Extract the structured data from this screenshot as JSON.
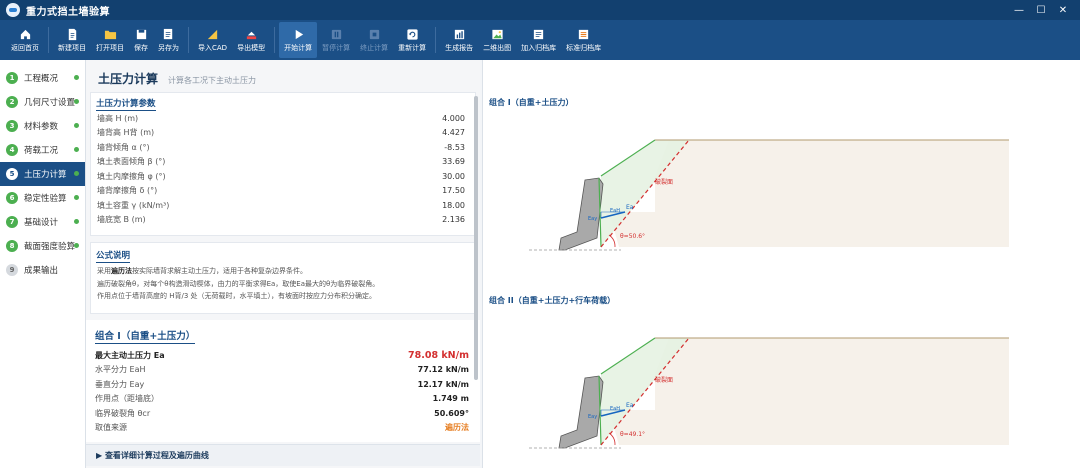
{
  "app": {
    "title": "重力式挡土墙验算"
  },
  "window_controls": {
    "minimize": "—",
    "maximize": "☐",
    "close": "✕"
  },
  "toolbar": [
    {
      "id": "home",
      "label": "返回首页",
      "icon": "home-icon",
      "state": "normal"
    },
    {
      "sep": true
    },
    {
      "id": "new",
      "label": "新建项目",
      "icon": "new-file-icon",
      "state": "normal"
    },
    {
      "id": "open",
      "label": "打开项目",
      "icon": "folder-icon",
      "state": "normal"
    },
    {
      "id": "save",
      "label": "保存",
      "icon": "save-icon",
      "state": "normal"
    },
    {
      "id": "saveas",
      "label": "另存为",
      "icon": "save-as-icon",
      "state": "normal"
    },
    {
      "sep": true
    },
    {
      "id": "cad",
      "label": "导入CAD",
      "icon": "cad-icon",
      "state": "normal"
    },
    {
      "id": "export",
      "label": "导出模型",
      "icon": "export-icon",
      "state": "normal"
    },
    {
      "sep": true
    },
    {
      "id": "start",
      "label": "开始计算",
      "icon": "play-icon",
      "state": "active"
    },
    {
      "id": "pause",
      "label": "暂停计算",
      "icon": "pause-icon",
      "state": "disabled"
    },
    {
      "id": "stop",
      "label": "终止计算",
      "icon": "stop-icon",
      "state": "disabled"
    },
    {
      "id": "recalc",
      "label": "重新计算",
      "icon": "refresh-icon",
      "state": "normal"
    },
    {
      "sep": true
    },
    {
      "id": "report",
      "label": "生成报告",
      "icon": "chart-icon",
      "state": "normal"
    },
    {
      "id": "draw2d",
      "label": "二维出图",
      "icon": "picture-icon",
      "state": "normal"
    },
    {
      "id": "addlib",
      "label": "加入归档库",
      "icon": "archive-add-icon",
      "state": "normal"
    },
    {
      "id": "stdlib",
      "label": "标准归档库",
      "icon": "archive-icon",
      "state": "normal"
    }
  ],
  "sidebar": {
    "items": [
      {
        "num": "1",
        "label": "工程概况",
        "done": true
      },
      {
        "num": "2",
        "label": "几何尺寸设置",
        "done": true
      },
      {
        "num": "3",
        "label": "材料参数",
        "done": true
      },
      {
        "num": "4",
        "label": "荷载工况",
        "done": true
      },
      {
        "num": "5",
        "label": "土压力计算",
        "done": true,
        "active": true
      },
      {
        "num": "6",
        "label": "稳定性验算",
        "done": true
      },
      {
        "num": "7",
        "label": "基础设计",
        "done": true
      },
      {
        "num": "8",
        "label": "截面强度验算",
        "done": true
      },
      {
        "num": "9",
        "label": "成果输出",
        "done": false
      }
    ]
  },
  "page": {
    "title": "土压力计算",
    "subtitle": "计算各工况下主动土压力"
  },
  "params": {
    "title": "土压力计算参数",
    "rows": [
      {
        "k": "墙高 H (m)",
        "v": "4.000"
      },
      {
        "k": "墙背高 H背 (m)",
        "v": "4.427"
      },
      {
        "k": "墙背倾角 α (°)",
        "v": "-8.53"
      },
      {
        "k": "填土表面倾角 β (°)",
        "v": "33.69"
      },
      {
        "k": "填土内摩擦角 φ (°)",
        "v": "30.00"
      },
      {
        "k": "墙背摩擦角 δ (°)",
        "v": "17.50"
      },
      {
        "k": "填土容重 γ (kN/m³)",
        "v": "18.00"
      },
      {
        "k": "墙底宽 B (m)",
        "v": "2.136"
      }
    ]
  },
  "formula": {
    "title": "公式说明",
    "line1_pre": "采用",
    "line1_bold": "遍历法",
    "line1_post": "按实际墙背求解主动土压力，适用于各种复杂边界条件。",
    "line2": "遍历破裂角θ，对每个θ构造滑动楔体，由力的平衡求得Ea，取使Ea最大的θ为临界破裂角。",
    "line3": "作用点位于墙背高度的 H背/3 处（无荷载时，水平填土），有坡面时按应力分布积分确定。"
  },
  "result": {
    "title": "组合 I（自重+土压力）",
    "rows": [
      {
        "k": "最大主动土压力 Ea",
        "v": "78.08 kN/m",
        "style": "main"
      },
      {
        "k": "水平分力 EaH",
        "v": "77.12 kN/m",
        "style": "normal"
      },
      {
        "k": "垂直分力 Eay",
        "v": "12.17 kN/m",
        "style": "normal"
      },
      {
        "k": "作用点（距墙底）",
        "v": "1.749 m",
        "style": "normal"
      },
      {
        "k": "临界破裂角 θcr",
        "v": "50.609°",
        "style": "normal"
      },
      {
        "k": "取值来源",
        "v": "遍历法",
        "style": "orange"
      }
    ],
    "detail_link": "▶  查看详细计算过程及遍历曲线"
  },
  "figures": [
    {
      "title": "组合 I（自重+土压力）",
      "theta_label": "θ=50.6°",
      "ea": "Ea",
      "eah": "EaH",
      "eay": "Eay",
      "slip": "破裂面"
    },
    {
      "title": "组合 II（自重+土压力+行车荷载）",
      "theta_label": "θ=49.1°",
      "ea": "Ea",
      "eah": "EaH",
      "eay": "Eay",
      "slip": "破裂面"
    }
  ],
  "colors": {
    "brand": "#1b4f86",
    "title_bar": "#12406f",
    "done": "#4caf50",
    "red": "#d32f2f",
    "orange": "#e67e22",
    "blue_vec": "#1565c0"
  }
}
